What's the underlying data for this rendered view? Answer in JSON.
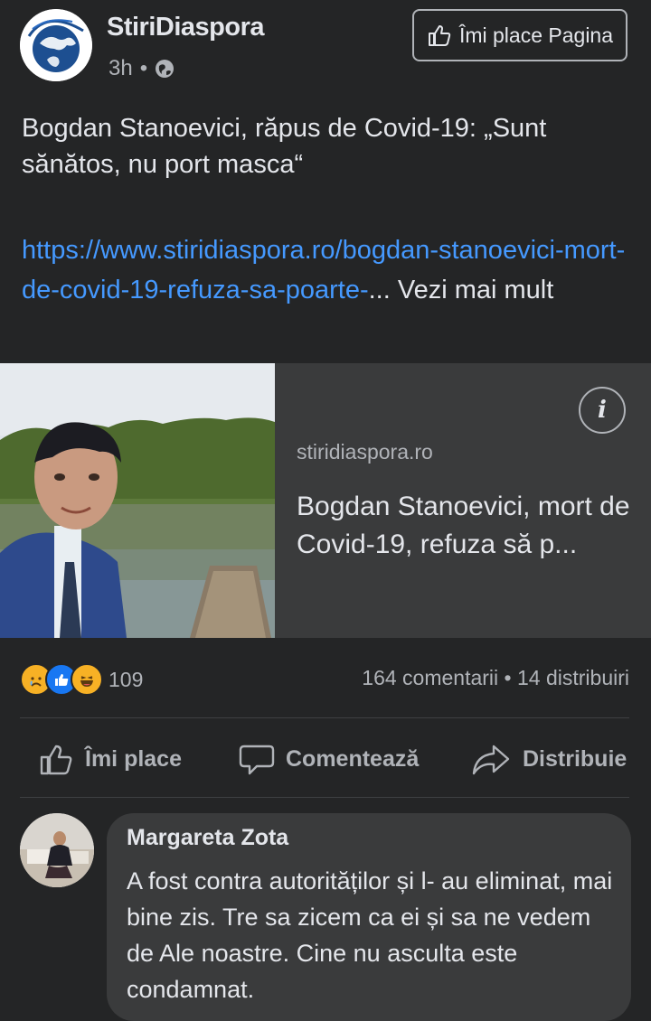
{
  "post": {
    "page_name": "StiriDiaspora",
    "time": "3h",
    "separator": "•",
    "privacy_icon": "globe-icon",
    "like_page_label": "Îmi place Pagina",
    "title": "Bogdan Stanoevici, răpus de Covid-19: „Sunt sănătos, nu port masca“",
    "link_text": "https://www.stiridiaspora.ro/bogdan-stanoevici-mort-de-covid-19-refuza-sa-poarte-",
    "ellipsis": "...",
    "see_more_label": "Vezi mai mult"
  },
  "link_card": {
    "domain": "stiridiaspora.ro",
    "title": "Bogdan Stanoevici, mort de Covid-19, refuza să p...",
    "info_label": "i"
  },
  "engagement": {
    "reaction_icons": [
      "sad-reaction-icon",
      "like-reaction-icon",
      "haha-reaction-icon"
    ],
    "reaction_count": "109",
    "comments": "164 comentarii",
    "separator": "•",
    "shares": "14 distribuiri"
  },
  "actions": {
    "like_label": "Îmi place",
    "comment_label": "Comentează",
    "share_label": "Distribuie"
  },
  "comment": {
    "author": "Margareta Zota",
    "text": "A fost contra autorităților și l- au eliminat, mai bine zis. Tre sa zicem ca ei și sa ne vedem de Ale noastre. Cine nu asculta este condamnat."
  },
  "colors": {
    "background": "#242526",
    "card": "#3a3b3c",
    "link": "#4599ff",
    "text": "#e4e6eb",
    "muted": "#b0b3b8"
  }
}
